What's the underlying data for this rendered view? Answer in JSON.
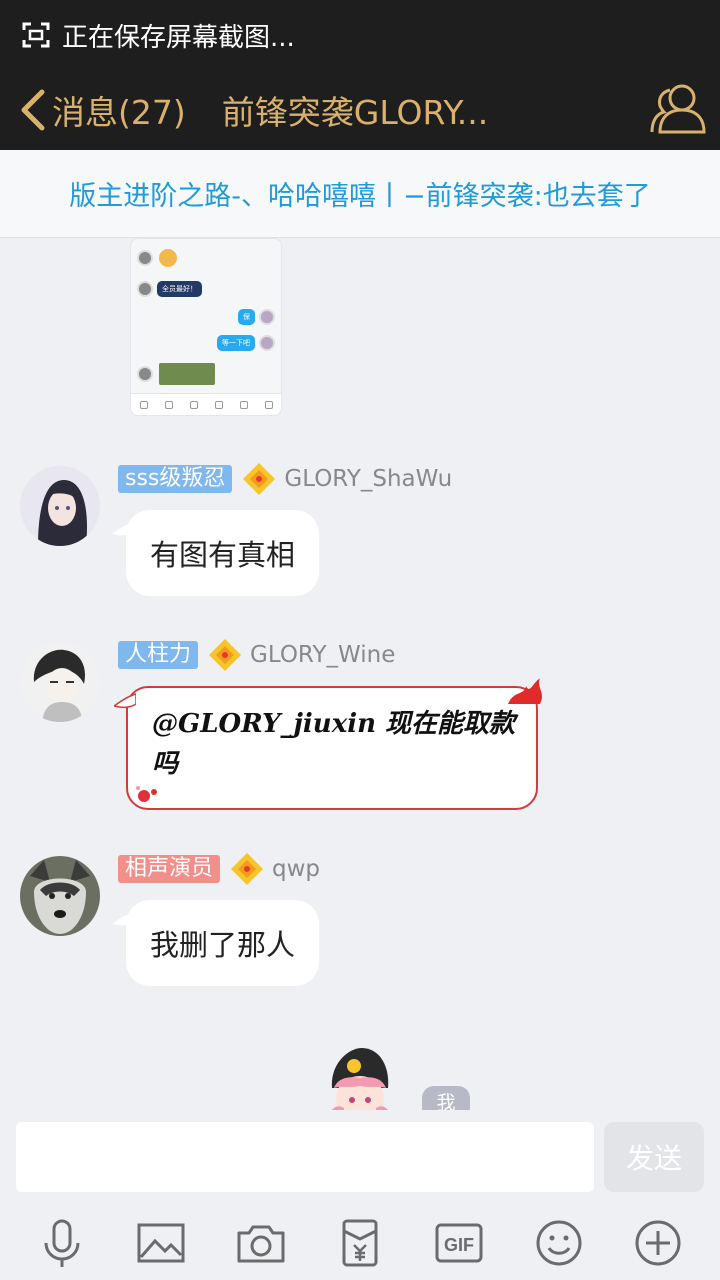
{
  "status": {
    "text": "正在保存屏幕截图..."
  },
  "header": {
    "back_label": "消息(27)",
    "title": "前锋突袭GLORY..."
  },
  "notice": {
    "text": "版主进阶之路-、哈哈嘻嘻丨−前锋突袭:也去套了"
  },
  "shot_thumb": {
    "line1": "全员最好！",
    "line2": "保",
    "line3": "等一下吧"
  },
  "messages": [
    {
      "title": "sss级叛忍",
      "nick": "GLORY_ShaWu",
      "text": "有图有真相",
      "badge_color": "#7fb7ef"
    },
    {
      "title": "人柱力",
      "nick": "GLORY_Wine",
      "text": "@GLORY_jiuxin 现在能取款吗",
      "badge_color": "#7fb7ef"
    },
    {
      "title": "相声演员",
      "nick": "qwp",
      "text": "我删了那人",
      "badge_color": "#f28f8a"
    }
  ],
  "self": {
    "label": "我"
  },
  "composer": {
    "placeholder": "",
    "send_label": "发送"
  },
  "toolbar": {
    "icons": [
      "microphone-icon",
      "image-icon",
      "camera-icon",
      "red-packet-icon",
      "gif-icon",
      "emoji-icon",
      "plus-icon"
    ],
    "gif_label": "GIF"
  },
  "colors": {
    "header_bg": "#1e1e1e",
    "accent_gold": "#d9b16a",
    "notice_text": "#1f9bd8",
    "chat_bg": "#eef0f4"
  }
}
